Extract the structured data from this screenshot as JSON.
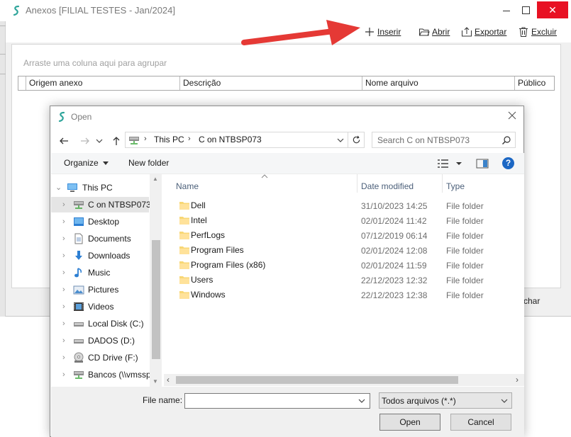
{
  "bg_window": {
    "title": "Anexos [FILIAL TESTES - Jan/2024]",
    "close_glyph": "✕",
    "toolbar": [
      {
        "id": "inserir",
        "label": "Inserir",
        "icon": "plus-icon"
      },
      {
        "id": "abrir",
        "label": "Abrir",
        "icon": "open-folder-icon"
      },
      {
        "id": "exportar",
        "label": "Exportar",
        "icon": "export-icon"
      },
      {
        "id": "excluir",
        "label": "Excluir",
        "icon": "trash-icon"
      }
    ],
    "group_hint": "Arraste uma coluna aqui para agrupar",
    "columns": [
      "Origem anexo",
      "Descrição",
      "Nome arquivo",
      "Público"
    ],
    "partial_button_text": "char",
    "close_color": "#e81123",
    "annotation_arrow_color": "#e53935"
  },
  "dialog": {
    "title": "Open",
    "breadcrumb": [
      "This PC",
      "C on NTBSP073"
    ],
    "search_placeholder": "Search C on NTBSP073",
    "organize_label": "Organize",
    "new_folder_label": "New folder",
    "help_glyph": "?",
    "nav_items": [
      {
        "label": "This PC",
        "icon": "computer-icon",
        "level": 0,
        "expanded": true,
        "selected": false
      },
      {
        "label": "C on NTBSP073",
        "icon": "network-drive-icon",
        "level": 1,
        "expanded": false,
        "selected": true
      },
      {
        "label": "Desktop",
        "icon": "desktop-icon",
        "level": 1,
        "expanded": false,
        "selected": false
      },
      {
        "label": "Documents",
        "icon": "documents-icon",
        "level": 1,
        "expanded": false,
        "selected": false
      },
      {
        "label": "Downloads",
        "icon": "downloads-icon",
        "level": 1,
        "expanded": false,
        "selected": false
      },
      {
        "label": "Music",
        "icon": "music-icon",
        "level": 1,
        "expanded": false,
        "selected": false
      },
      {
        "label": "Pictures",
        "icon": "pictures-icon",
        "level": 1,
        "expanded": false,
        "selected": false
      },
      {
        "label": "Videos",
        "icon": "videos-icon",
        "level": 1,
        "expanded": false,
        "selected": false
      },
      {
        "label": "Local Disk (C:)",
        "icon": "local-disk-icon",
        "level": 1,
        "expanded": false,
        "selected": false
      },
      {
        "label": "DADOS (D:)",
        "icon": "local-disk-icon",
        "level": 1,
        "expanded": false,
        "selected": false
      },
      {
        "label": "CD Drive (F:)",
        "icon": "cd-drive-icon",
        "level": 1,
        "expanded": false,
        "selected": false
      },
      {
        "label": "Bancos (\\\\vmssp",
        "icon": "network-drive-icon",
        "level": 1,
        "expanded": false,
        "selected": false
      }
    ],
    "file_columns": {
      "name": "Name",
      "date": "Date modified",
      "type": "Type"
    },
    "files": [
      {
        "name": "Dell",
        "date": "31/10/2023 14:25",
        "type": "File folder"
      },
      {
        "name": "Intel",
        "date": "02/01/2024 11:42",
        "type": "File folder"
      },
      {
        "name": "PerfLogs",
        "date": "07/12/2019 06:14",
        "type": "File folder"
      },
      {
        "name": "Program Files",
        "date": "02/01/2024 12:08",
        "type": "File folder"
      },
      {
        "name": "Program Files (x86)",
        "date": "02/01/2024 11:59",
        "type": "File folder"
      },
      {
        "name": "Users",
        "date": "22/12/2023 12:32",
        "type": "File folder"
      },
      {
        "name": "Windows",
        "date": "22/12/2023 12:38",
        "type": "File folder"
      }
    ],
    "file_name_label": "File name:",
    "file_name_value": "",
    "filter_value": "Todos arquivos (*.*)",
    "open_label": "Open",
    "cancel_label": "Cancel",
    "folder_color": "#f8d775",
    "accent_color": "#1c67c4"
  }
}
